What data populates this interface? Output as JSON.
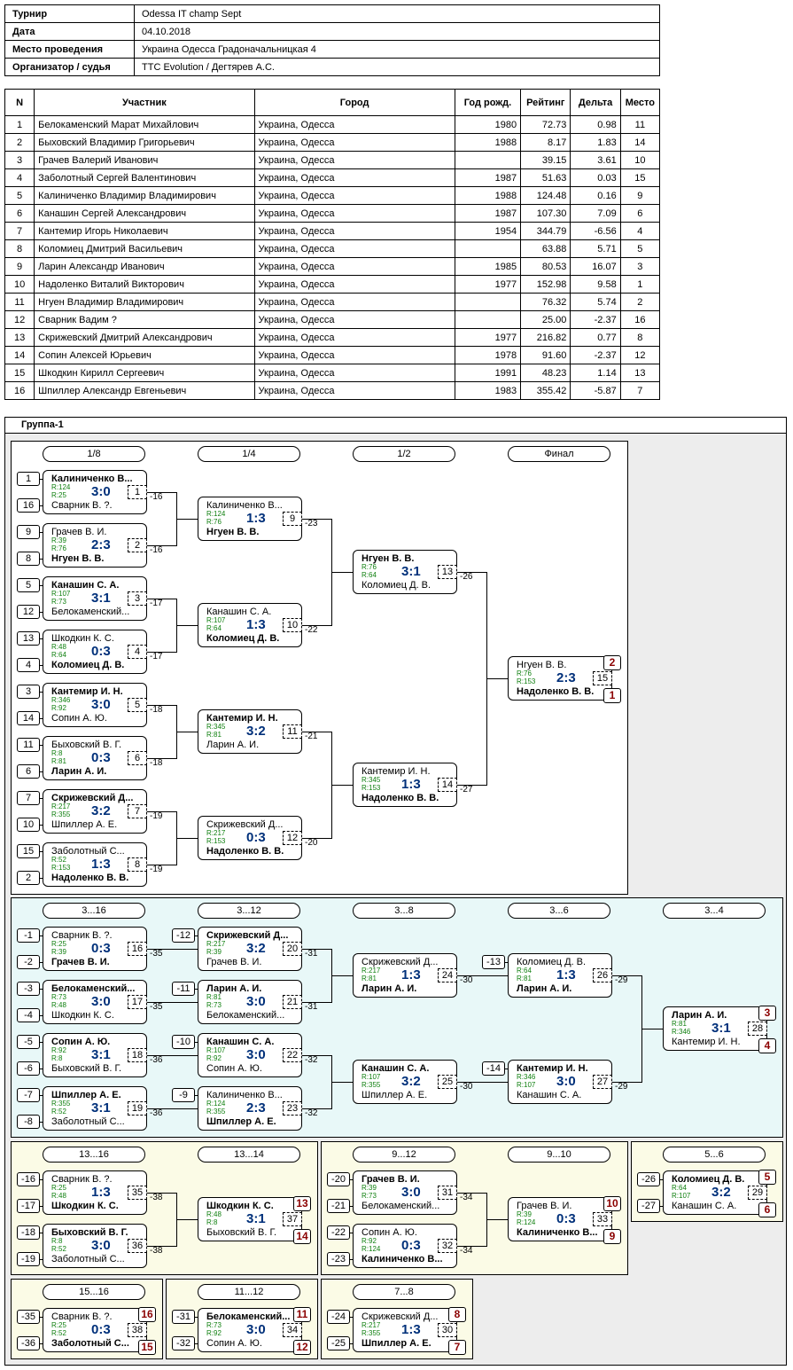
{
  "info": [
    {
      "key": "Турнир",
      "value": "Odessa IT champ Sept"
    },
    {
      "key": "Дата",
      "value": "04.10.2018"
    },
    {
      "key": "Место проведения",
      "value": "Украина Одесса Градоначальницкая 4"
    },
    {
      "key": "Организатор / судья",
      "value": "TTC Evolution / Дегтярев А.С."
    }
  ],
  "players_table": {
    "headers": [
      "N",
      "Участник",
      "Город",
      "Год рожд.",
      "Рейтинг",
      "Дельта",
      "Место"
    ],
    "rows": [
      [
        "1",
        "Белокаменский Марат Михайлович",
        "Украина, Одесса",
        "1980",
        "72.73",
        "0.98",
        "11"
      ],
      [
        "2",
        "Быховский Владимир Григорьевич",
        "Украина, Одесса",
        "1988",
        "8.17",
        "1.83",
        "14"
      ],
      [
        "3",
        "Грачев Валерий Иванович",
        "Украина, Одесса",
        "",
        "39.15",
        "3.61",
        "10"
      ],
      [
        "4",
        "Заболотный Сергей Валентинович",
        "Украина, Одесса",
        "1987",
        "51.63",
        "0.03",
        "15"
      ],
      [
        "5",
        "Калиниченко Владимир Владимирович",
        "Украина, Одесса",
        "1988",
        "124.48",
        "0.16",
        "9"
      ],
      [
        "6",
        "Канашин Сергей Александрович",
        "Украина, Одесса",
        "1987",
        "107.30",
        "7.09",
        "6"
      ],
      [
        "7",
        "Кантемир Игорь Николаевич",
        "Украина, Одесса",
        "1954",
        "344.79",
        "-6.56",
        "4"
      ],
      [
        "8",
        "Коломиец Дмитрий Васильевич",
        "Украина, Одесса",
        "",
        "63.88",
        "5.71",
        "5"
      ],
      [
        "9",
        "Ларин Александр Иванович",
        "Украина, Одесса",
        "1985",
        "80.53",
        "16.07",
        "3"
      ],
      [
        "10",
        "Надоленко Виталий Викторович",
        "Украина, Одесса",
        "1977",
        "152.98",
        "9.58",
        "1"
      ],
      [
        "11",
        "Нгуен Владимир Владимирович",
        "Украина, Одесса",
        "",
        "76.32",
        "5.74",
        "2"
      ],
      [
        "12",
        "Сварник Вадим ?",
        "Украина, Одесса",
        "",
        "25.00",
        "-2.37",
        "16"
      ],
      [
        "13",
        "Скрижевский Дмитрий Александрович",
        "Украина, Одесса",
        "1977",
        "216.82",
        "0.77",
        "8"
      ],
      [
        "14",
        "Сопин Алексей Юрьевич",
        "Украина, Одесса",
        "1978",
        "91.60",
        "-2.37",
        "12"
      ],
      [
        "15",
        "Шкодкин Кирилл Сергеевич",
        "Украина, Одесса",
        "1991",
        "48.23",
        "1.14",
        "13"
      ],
      [
        "16",
        "Шпиллер Александр Евгеньевич",
        "Украина, Одесса",
        "1983",
        "355.42",
        "-5.87",
        "7"
      ]
    ]
  },
  "group_title": "Группа-1",
  "round_labels": {
    "main": [
      "1/8",
      "1/4",
      "1/2",
      "Финал"
    ],
    "cons": [
      "3...16",
      "3...12",
      "3...8",
      "3...6",
      "3...4"
    ],
    "y1": [
      "13...16",
      "13...14"
    ],
    "y2": [
      "9...12",
      "9...10"
    ],
    "y3": [
      "5...6"
    ],
    "y4": [
      "15...16"
    ],
    "y5": [
      "11...12"
    ],
    "y6": [
      "7...8"
    ]
  },
  "seeds": {
    "main": [
      "1",
      "16",
      "9",
      "8",
      "5",
      "12",
      "13",
      "4",
      "3",
      "14",
      "11",
      "6",
      "7",
      "10",
      "15",
      "2"
    ],
    "cons1": [
      "-1",
      "-2",
      "-3",
      "-4",
      "-5",
      "-6",
      "-7",
      "-8"
    ],
    "cons2": [
      "-12",
      "-11",
      "-10",
      "-9"
    ],
    "cons4": [
      "-13",
      "-14"
    ],
    "y1": [
      "-16",
      "-17",
      "-18",
      "-19"
    ],
    "y2": [
      "-20",
      "-21",
      "-22",
      "-23"
    ],
    "y3": [
      "-26",
      "-27"
    ],
    "y4": [
      "-35",
      "-36"
    ],
    "y5": [
      "-31",
      "-32"
    ],
    "y6": [
      "-24",
      "-25"
    ]
  },
  "matches": [
    {
      "p1": "Калиниченко В...",
      "b1": true,
      "p2": "Сварник В. ?.",
      "b2": false,
      "r1": "R:124",
      "r2": "R:25",
      "score": "3:0",
      "num": "1",
      "ann": "-16"
    },
    {
      "p1": "Грачев В. И.",
      "b1": false,
      "p2": "Нгуен В. В.",
      "b2": true,
      "r1": "R:39",
      "r2": "R:76",
      "score": "2:3",
      "num": "2",
      "ann": "-16"
    },
    {
      "p1": "Канашин С. А.",
      "b1": true,
      "p2": "Белокаменский...",
      "b2": false,
      "r1": "R:107",
      "r2": "R:73",
      "score": "3:1",
      "num": "3",
      "ann": "-17"
    },
    {
      "p1": "Шкодкин К. С.",
      "b1": false,
      "p2": "Коломиец Д. В.",
      "b2": true,
      "r1": "R:48",
      "r2": "R:64",
      "score": "0:3",
      "num": "4",
      "ann": "-17"
    },
    {
      "p1": "Кантемир И. Н.",
      "b1": true,
      "p2": "Сопин А. Ю.",
      "b2": false,
      "r1": "R:346",
      "r2": "R:92",
      "score": "3:0",
      "num": "5",
      "ann": "-18"
    },
    {
      "p1": "Быховский В. Г.",
      "b1": false,
      "p2": "Ларин А. И.",
      "b2": true,
      "r1": "R:8",
      "r2": "R:81",
      "score": "0:3",
      "num": "6",
      "ann": "-18"
    },
    {
      "p1": "Скрижевский Д...",
      "b1": true,
      "p2": "Шпиллер А. Е.",
      "b2": false,
      "r1": "R:217",
      "r2": "R:355",
      "score": "3:2",
      "num": "7",
      "ann": "-19"
    },
    {
      "p1": "Заболотный С...",
      "b1": false,
      "p2": "Надоленко В. В.",
      "b2": true,
      "r1": "R:52",
      "r2": "R:153",
      "score": "1:3",
      "num": "8",
      "ann": "-19"
    },
    {
      "p1": "Калиниченко В...",
      "b1": false,
      "p2": "Нгуен В. В.",
      "b2": true,
      "r1": "R:124",
      "r2": "R:76",
      "score": "1:3",
      "num": "9",
      "ann": "-23"
    },
    {
      "p1": "Канашин С. А.",
      "b1": false,
      "p2": "Коломиец Д. В.",
      "b2": true,
      "r1": "R:107",
      "r2": "R:64",
      "score": "1:3",
      "num": "10",
      "ann": "-22"
    },
    {
      "p1": "Кантемир И. Н.",
      "b1": true,
      "p2": "Ларин А. И.",
      "b2": false,
      "r1": "R:345",
      "r2": "R:81",
      "score": "3:2",
      "num": "11",
      "ann": "-21"
    },
    {
      "p1": "Скрижевский Д...",
      "b1": false,
      "p2": "Надоленко В. В.",
      "b2": true,
      "r1": "R:217",
      "r2": "R:153",
      "score": "0:3",
      "num": "12",
      "ann": "-20"
    },
    {
      "p1": "Нгуен В. В.",
      "b1": true,
      "p2": "Коломиец Д. В.",
      "b2": false,
      "r1": "R:76",
      "r2": "R:64",
      "score": "3:1",
      "num": "13",
      "ann": "-26"
    },
    {
      "p1": "Кантемир И. Н.",
      "b1": false,
      "p2": "Надоленко В. В.",
      "b2": true,
      "r1": "R:345",
      "r2": "R:153",
      "score": "1:3",
      "num": "14",
      "ann": "-27"
    },
    {
      "p1": "Нгуен В. В.",
      "b1": false,
      "p2": "Надоленко В. В.",
      "b2": true,
      "r1": "R:76",
      "r2": "R:153",
      "score": "2:3",
      "num": "15",
      "ann": "",
      "place1": "2",
      "place2": "1"
    },
    {
      "p1": "Сварник В. ?.",
      "b1": false,
      "p2": "Грачев В. И.",
      "b2": true,
      "r1": "R:25",
      "r2": "R:39",
      "score": "0:3",
      "num": "16",
      "ann": "-35"
    },
    {
      "p1": "Белокаменский...",
      "b1": true,
      "p2": "Шкодкин К. С.",
      "b2": false,
      "r1": "R:73",
      "r2": "R:48",
      "score": "3:0",
      "num": "17",
      "ann": "-35"
    },
    {
      "p1": "Сопин А. Ю.",
      "b1": true,
      "p2": "Быховский В. Г.",
      "b2": false,
      "r1": "R:92",
      "r2": "R:8",
      "score": "3:1",
      "num": "18",
      "ann": "-36"
    },
    {
      "p1": "Шпиллер А. Е.",
      "b1": true,
      "p2": "Заболотный С...",
      "b2": false,
      "r1": "R:355",
      "r2": "R:52",
      "score": "3:1",
      "num": "19",
      "ann": "-36"
    },
    {
      "p1": "Скрижевский Д...",
      "b1": true,
      "p2": "Грачев В. И.",
      "b2": false,
      "r1": "R:217",
      "r2": "R:39",
      "score": "3:2",
      "num": "20",
      "ann": "-31"
    },
    {
      "p1": "Ларин А. И.",
      "b1": true,
      "p2": "Белокаменский...",
      "b2": false,
      "r1": "R:81",
      "r2": "R:73",
      "score": "3:0",
      "num": "21",
      "ann": "-31"
    },
    {
      "p1": "Канашин С. А.",
      "b1": true,
      "p2": "Сопин А. Ю.",
      "b2": false,
      "r1": "R:107",
      "r2": "R:92",
      "score": "3:0",
      "num": "22",
      "ann": "-32"
    },
    {
      "p1": "Калиниченко В...",
      "b1": false,
      "p2": "Шпиллер А. Е.",
      "b2": true,
      "r1": "R:124",
      "r2": "R:355",
      "score": "2:3",
      "num": "23",
      "ann": "-32"
    },
    {
      "p1": "Скрижевский Д...",
      "b1": false,
      "p2": "Ларин А. И.",
      "b2": true,
      "r1": "R:217",
      "r2": "R:81",
      "score": "1:3",
      "num": "24",
      "ann": "-30"
    },
    {
      "p1": "Канашин С. А.",
      "b1": true,
      "p2": "Шпиллер А. Е.",
      "b2": false,
      "r1": "R:107",
      "r2": "R:355",
      "score": "3:2",
      "num": "25",
      "ann": "-30"
    },
    {
      "p1": "Коломиец Д. В.",
      "b1": false,
      "p2": "Ларин А. И.",
      "b2": true,
      "r1": "R:64",
      "r2": "R:81",
      "score": "1:3",
      "num": "26",
      "ann": "-29"
    },
    {
      "p1": "Кантемир И. Н.",
      "b1": true,
      "p2": "Канашин С. А.",
      "b2": false,
      "r1": "R:346",
      "r2": "R:107",
      "score": "3:0",
      "num": "27",
      "ann": "-29"
    },
    {
      "p1": "Ларин А. И.",
      "b1": true,
      "p2": "Кантемир И. Н.",
      "b2": false,
      "r1": "R:81",
      "r2": "R:346",
      "score": "3:1",
      "num": "28",
      "ann": "",
      "place1": "3",
      "place2": "4"
    },
    {
      "p1": "Сварник В. ?.",
      "b1": false,
      "p2": "Шкодкин К. С.",
      "b2": true,
      "r1": "R:25",
      "r2": "R:48",
      "score": "1:3",
      "num": "35",
      "ann": "-38"
    },
    {
      "p1": "Быховский В. Г.",
      "b1": true,
      "p2": "Заболотный С...",
      "b2": false,
      "r1": "R:8",
      "r2": "R:52",
      "score": "3:0",
      "num": "36",
      "ann": "-38"
    },
    {
      "p1": "Шкодкин К. С.",
      "b1": true,
      "p2": "Быховский В. Г.",
      "b2": false,
      "r1": "R:48",
      "r2": "R:8",
      "score": "3:1",
      "num": "37",
      "ann": "",
      "place1": "13",
      "place2": "14"
    },
    {
      "p1": "Грачев В. И.",
      "b1": true,
      "p2": "Белокаменский...",
      "b2": false,
      "r1": "R:39",
      "r2": "R:73",
      "score": "3:0",
      "num": "31",
      "ann": "-34"
    },
    {
      "p1": "Сопин А. Ю.",
      "b1": false,
      "p2": "Калиниченко В...",
      "b2": true,
      "r1": "R:92",
      "r2": "R:124",
      "score": "0:3",
      "num": "32",
      "ann": "-34"
    },
    {
      "p1": "Грачев В. И.",
      "b1": false,
      "p2": "Калиниченко В...",
      "b2": true,
      "r1": "R:39",
      "r2": "R:124",
      "score": "0:3",
      "num": "33",
      "ann": "",
      "place1": "10",
      "place2": "9"
    },
    {
      "p1": "Коломиец Д. В.",
      "b1": true,
      "p2": "Канашин С. А.",
      "b2": false,
      "r1": "R:64",
      "r2": "R:107",
      "score": "3:2",
      "num": "29",
      "ann": "",
      "place1": "5",
      "place2": "6"
    },
    {
      "p1": "Сварник В. ?.",
      "b1": false,
      "p2": "Заболотный С...",
      "b2": true,
      "r1": "R:25",
      "r2": "R:52",
      "score": "0:3",
      "num": "38",
      "ann": "",
      "place1": "16",
      "place2": "15"
    },
    {
      "p1": "Белокаменский...",
      "b1": true,
      "p2": "Сопин А. Ю.",
      "b2": false,
      "r1": "R:73",
      "r2": "R:92",
      "score": "3:0",
      "num": "34",
      "ann": "",
      "place1": "11",
      "place2": "12"
    },
    {
      "p1": "Скрижевский Д...",
      "b1": false,
      "p2": "Шпиллер А. Е.",
      "b2": true,
      "r1": "R:217",
      "r2": "R:355",
      "score": "1:3",
      "num": "30",
      "ann": "",
      "place1": "8",
      "place2": "7"
    }
  ]
}
